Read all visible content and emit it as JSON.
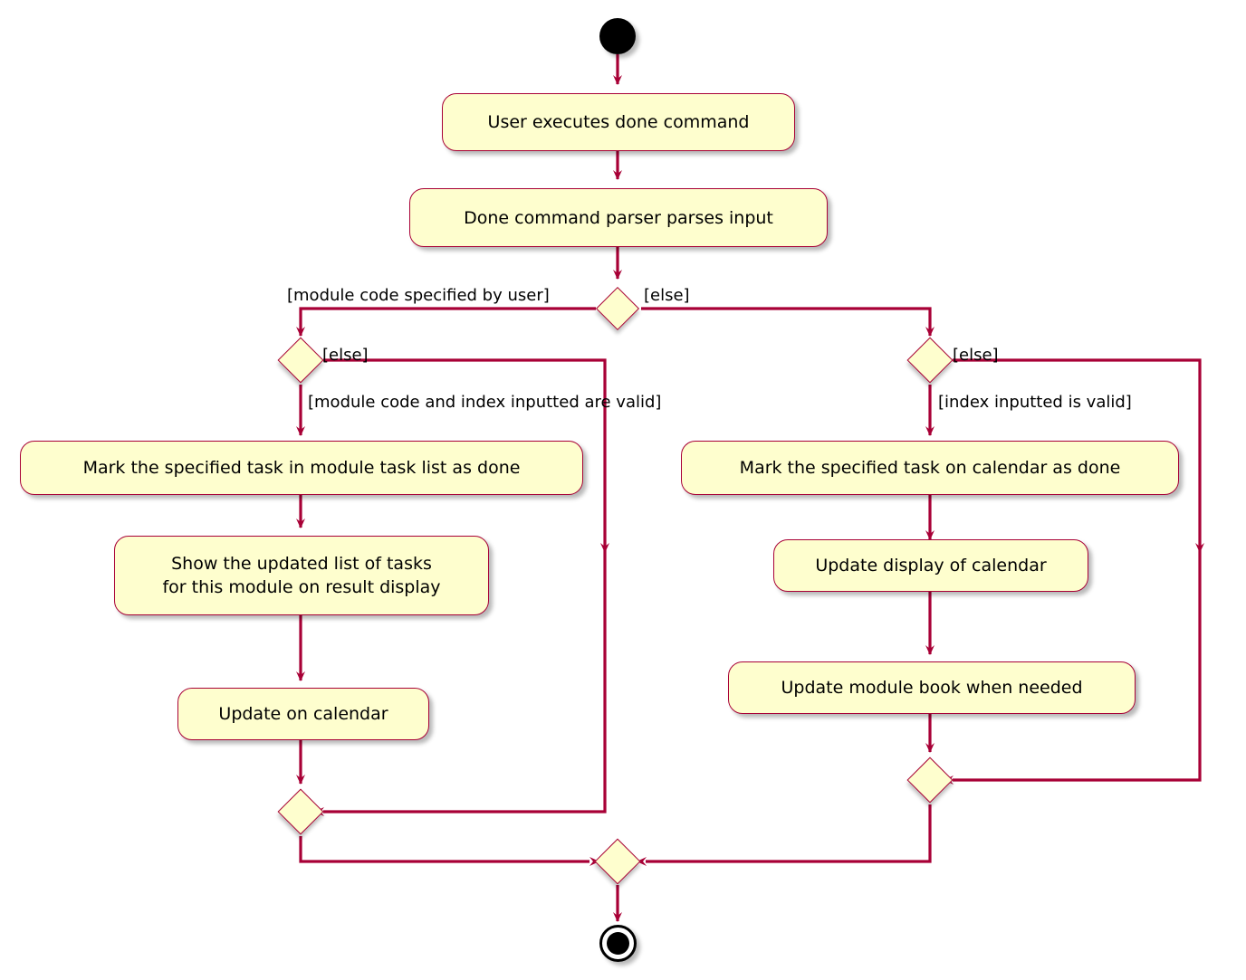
{
  "diagram": {
    "type": "uml-activity-diagram",
    "title": "Done command activity diagram",
    "theme": {
      "node_fill": "#FEFECE",
      "node_border": "#A80036",
      "edge_color": "#A80036",
      "text_color": "#000000",
      "background": "#FFFFFF"
    },
    "start": {
      "name": "start-node"
    },
    "end": {
      "name": "end-node"
    },
    "activities": [
      {
        "id": "a1",
        "label": "User executes done command"
      },
      {
        "id": "a2",
        "label": "Done command parser parses input"
      },
      {
        "id": "a3",
        "label": "Mark the specified task in module task list as done"
      },
      {
        "id": "a4",
        "label": "Show the updated list of tasks\nfor this module on result display"
      },
      {
        "id": "a5",
        "label": "Update on calendar"
      },
      {
        "id": "a6",
        "label": "Mark the specified task on calendar as done"
      },
      {
        "id": "a7",
        "label": "Update display of calendar"
      },
      {
        "id": "a8",
        "label": "Update module book when needed"
      }
    ],
    "decisions": [
      {
        "id": "d1",
        "name": "decision-module-code-specified"
      },
      {
        "id": "d2",
        "name": "decision-module-code-and-index-valid"
      },
      {
        "id": "d3",
        "name": "decision-index-valid"
      }
    ],
    "merges": [
      {
        "id": "m1",
        "name": "merge-left-branch"
      },
      {
        "id": "m2",
        "name": "merge-right-branch"
      },
      {
        "id": "m3",
        "name": "merge-final"
      }
    ],
    "guards": [
      {
        "id": "g1",
        "text": "[module code specified by user]"
      },
      {
        "id": "g2",
        "text": "[else]"
      },
      {
        "id": "g3",
        "text": "[else]"
      },
      {
        "id": "g4",
        "text": "[module code and index inputted are valid]"
      },
      {
        "id": "g5",
        "text": "[else]"
      },
      {
        "id": "g6",
        "text": "[index inputted is valid]"
      }
    ]
  }
}
